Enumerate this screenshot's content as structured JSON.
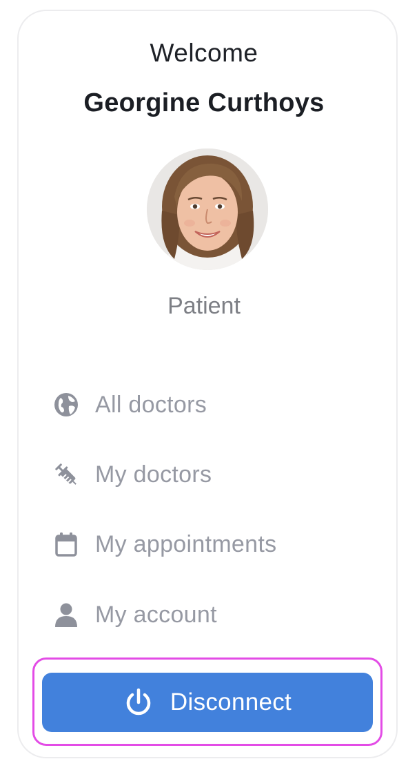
{
  "header": {
    "greeting": "Welcome",
    "user_name": "Georgine Curthoys",
    "role": "Patient"
  },
  "menu": {
    "items": [
      {
        "label": "All doctors",
        "icon": "globe-icon"
      },
      {
        "label": "My doctors",
        "icon": "syringe-icon"
      },
      {
        "label": "My appointments",
        "icon": "calendar-icon"
      },
      {
        "label": "My account",
        "icon": "user-icon"
      }
    ]
  },
  "actions": {
    "disconnect_label": "Disconnect",
    "disconnect_icon": "power-icon"
  },
  "colors": {
    "primary": "#4281dc",
    "menu_text": "#9699a3",
    "menu_icon": "#8e919b",
    "highlight": "#e34ce6"
  }
}
